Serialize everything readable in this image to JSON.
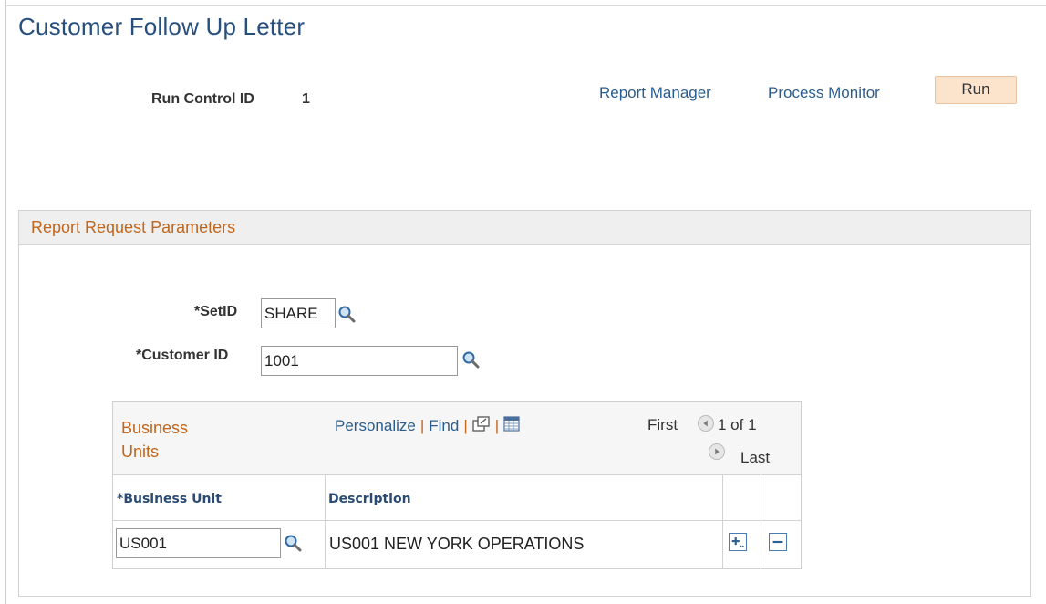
{
  "page": {
    "title": "Customer Follow Up Letter"
  },
  "run_control": {
    "label": "Run Control ID",
    "value": "1"
  },
  "links": {
    "report_manager": "Report Manager",
    "process_monitor": "Process Monitor"
  },
  "run_button": "Run",
  "section": {
    "title": "Report Request Parameters"
  },
  "fields": {
    "setid": {
      "label": "*SetID",
      "value": "SHARE"
    },
    "customer_id": {
      "label": "*Customer ID",
      "value": "1001"
    }
  },
  "grid": {
    "title": "Business Units",
    "toolbar": {
      "personalize": "Personalize",
      "find": "Find",
      "separator": "|"
    },
    "nav": {
      "first": "First",
      "count": "1 of 1",
      "last": "Last"
    },
    "columns": [
      "*Business Unit",
      "Description"
    ],
    "rows": [
      {
        "business_unit": "US001",
        "description": "US001 NEW YORK OPERATIONS"
      }
    ]
  },
  "icons": {
    "lookup": "lookup-magnifier-icon",
    "new_window": "new-window-icon",
    "spreadsheet": "download-spreadsheet-icon",
    "prev": "previous-arrow-icon",
    "next": "next-arrow-icon",
    "add_row": "add-row-icon",
    "delete_row": "delete-row-icon"
  },
  "colors": {
    "title_blue": "#264f7e",
    "link_blue": "#2a5d8f",
    "section_orange": "#c0661d",
    "run_button_bg": "#fce4cc"
  }
}
